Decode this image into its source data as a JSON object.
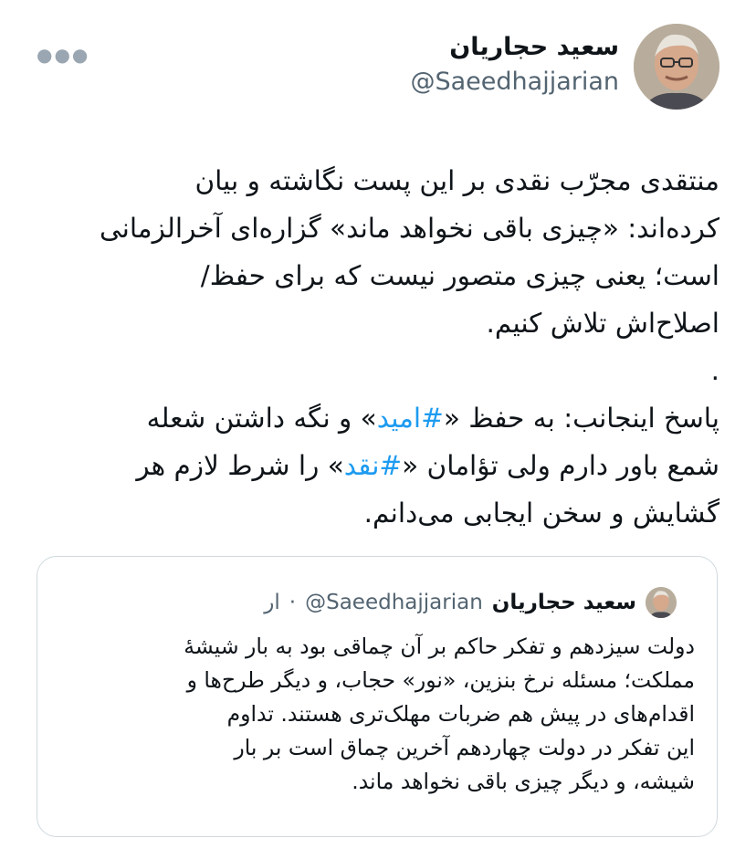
{
  "tweet": {
    "display_name": "سعید حجاریان",
    "handle": "@Saeedhajjarian",
    "more_icon": "more-horizontal-icon",
    "body": {
      "line1": "منتقدی مجرّب نقدی بر این پست نگاشته و بیان",
      "line2": "کرده‌اند: «چیزی باقی نخواهد ماند» گزاره‌ای آخرالزمانی",
      "line3": "است؛ یعنی چیزی متصور نیست که برای حفظ/",
      "line4": "اصلاح‌اش تلاش کنیم.",
      "line5": ".",
      "line6_a": "پاسخ اینجانب: به حفظ «",
      "hashtag1": "#امید",
      "line6_b": "» و نگه داشتن شعله",
      "line7_a": "شمع باور دارم ولی تؤامان «",
      "hashtag2": "#نقد",
      "line7_b": "» را شرط لازم هر",
      "line8": "گشایش و سخن ایجابی می‌دانم."
    },
    "hashtag_color": "#1d9bf0"
  },
  "quote": {
    "display_name": "سعید حجاریان",
    "handle": "@Saeedhajjarian",
    "separator": "·",
    "time": "ار",
    "lines": [
      "دولت سیزدهم و تفکر حاکم بر آن چماقی بود به بار شیشهٔ",
      "مملکت؛ مسئله نرخ بنزین، «نور» حجاب، و دیگر طرح‌ها و",
      "اقدام‌های در پیش هم ضربات مهلک‌تری هستند. تداوم",
      "این تفکر در دولت چهاردهم آخرین چماق است بر بار",
      "شیشه، و دیگر چیزی باقی نخواهد ماند."
    ]
  }
}
